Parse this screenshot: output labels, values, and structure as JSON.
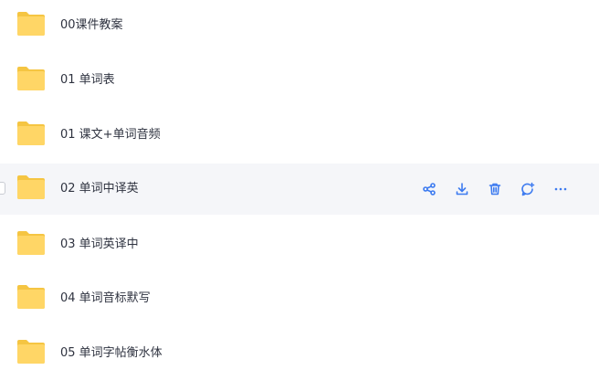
{
  "colors": {
    "folder_back": "#f5c542",
    "folder_front": "#ffd666",
    "text": "#2f3340",
    "hover_bg": "#f5f6f9",
    "accent": "#3d7bf0"
  },
  "files": [
    {
      "name": "00课件教案",
      "icon": "folder-icon"
    },
    {
      "name": "01 单词表",
      "icon": "folder-icon"
    },
    {
      "name": "01 课文+单词音频",
      "icon": "folder-icon"
    },
    {
      "name": "02 单词中译英",
      "icon": "folder-icon",
      "hovered": true
    },
    {
      "name": "03 单词英译中",
      "icon": "folder-icon"
    },
    {
      "name": "04 单词音标默写",
      "icon": "folder-icon"
    },
    {
      "name": "05 单词字帖衡水体",
      "icon": "folder-icon"
    }
  ],
  "row_actions": [
    {
      "icon": "share-icon"
    },
    {
      "icon": "download-icon"
    },
    {
      "icon": "delete-icon"
    },
    {
      "icon": "comment-icon"
    },
    {
      "icon": "more-icon"
    }
  ]
}
